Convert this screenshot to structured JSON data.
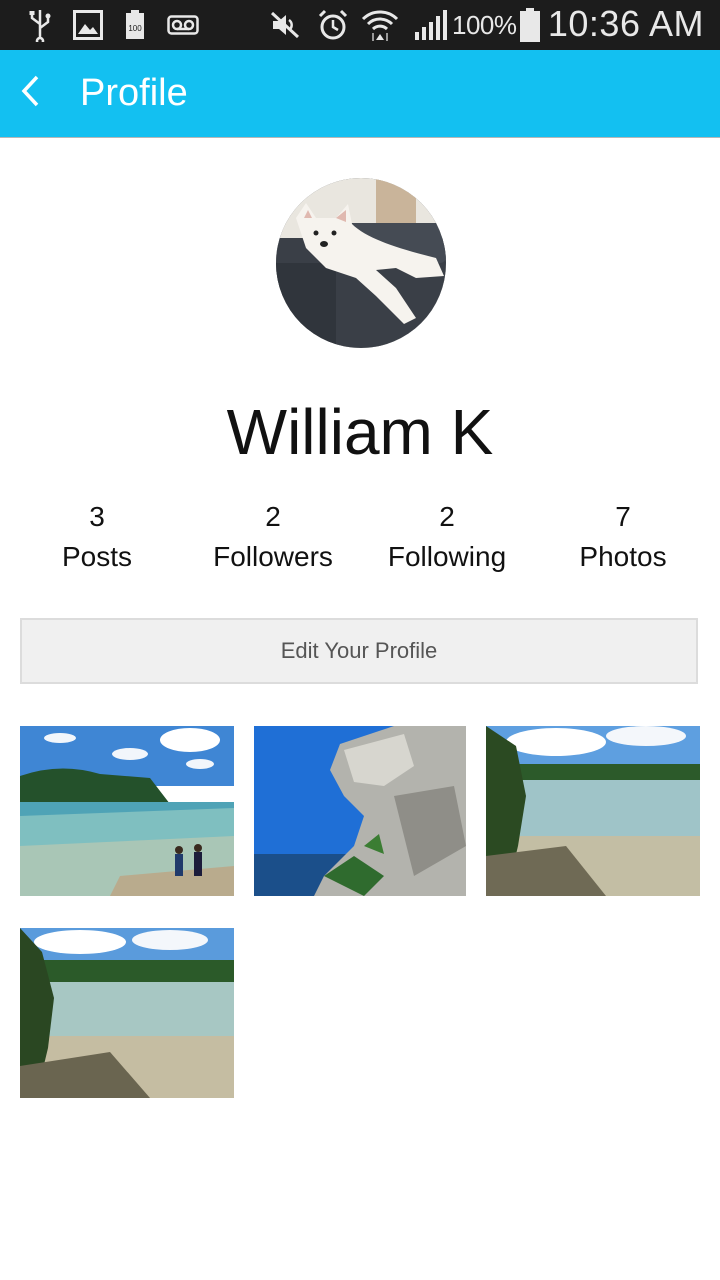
{
  "status_bar": {
    "battery_percent": "100%",
    "time": "10:36 AM",
    "icons": [
      "usb-icon",
      "image-notification-icon",
      "battery-saver-icon",
      "voicemail-icon",
      "mute-icon",
      "alarm-icon",
      "wifi-icon",
      "signal-icon",
      "battery-icon"
    ]
  },
  "app_bar": {
    "title": "Profile",
    "back_icon": "chevron-left-icon",
    "color": "#13c0f1"
  },
  "profile": {
    "name": "William K",
    "stats": [
      {
        "value": "3",
        "label": "Posts"
      },
      {
        "value": "2",
        "label": "Followers"
      },
      {
        "value": "2",
        "label": "Following"
      },
      {
        "value": "7",
        "label": "Photos"
      }
    ],
    "edit_button_label": "Edit Your Profile"
  },
  "photos": [
    {
      "subject": "beach-with-children"
    },
    {
      "subject": "rock-cliff"
    },
    {
      "subject": "lake-shore"
    },
    {
      "subject": "lake-shore"
    }
  ]
}
